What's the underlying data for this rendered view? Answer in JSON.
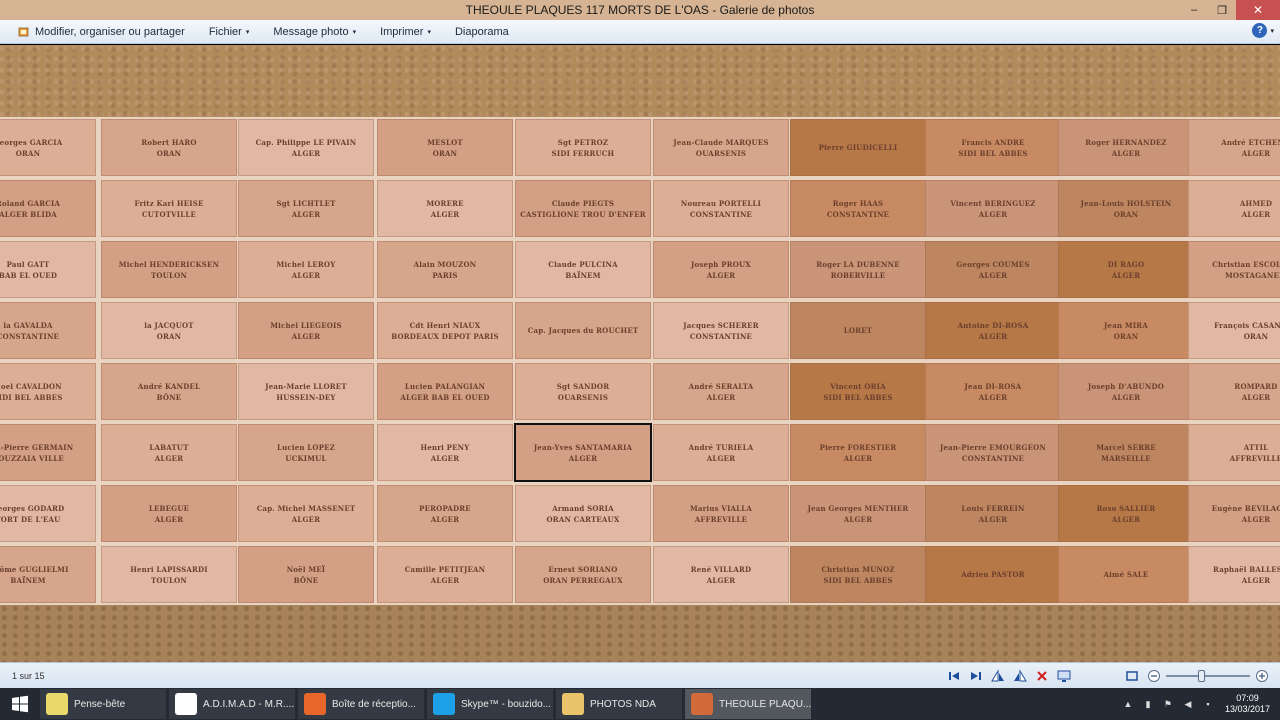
{
  "window": {
    "title": "THEOULE PLAQUES 117 MORTS DE L'OAS - Galerie de photos",
    "minimize": "–",
    "maximize": "❐",
    "close": "✕"
  },
  "toolbar": {
    "items": [
      {
        "label": "Modifier, organiser ou partager",
        "icon": "edit-icon"
      },
      {
        "label": "Fichier",
        "caret": "▾"
      },
      {
        "label": "Message photo",
        "caret": "▾"
      },
      {
        "label": "Imprimer",
        "caret": "▾"
      },
      {
        "label": "Diaporama"
      }
    ],
    "help": "?",
    "help_caret": "▾"
  },
  "photo": {
    "highlighted": "Jean-Yves SANTAMARIA / ALGER",
    "columns": [
      [
        [
          "Georges GARCIA",
          "ORAN"
        ],
        [
          "Roland GARCIA",
          "ALGER      BLIDA"
        ],
        [
          "Paul GATT",
          "BAB EL OUED"
        ],
        [
          "la GAVALDA",
          "CONSTANTINE"
        ],
        [
          "Noel CAVALDON",
          "SIDI BEL ABBES"
        ],
        [
          "Jean-Pierre GERMAIN",
          "BOUZZAIA VILLE"
        ],
        [
          "Georges GODARD",
          "FORT DE L'EAU"
        ],
        [
          "Jérôme GUGLIELMI",
          "BAÏNEM"
        ]
      ],
      [
        [
          "Robert HARO",
          "ORAN"
        ],
        [
          "Fritz Karl HEISE",
          "CUTOTVILLE"
        ],
        [
          "Michel HENDERICKSEN",
          "TOULON"
        ],
        [
          "la JACQUOT",
          "ORAN"
        ],
        [
          "André KANDEL",
          "BÔNE"
        ],
        [
          "LABATUT",
          "ALGER"
        ],
        [
          "LEBEGUE",
          "ALGER"
        ],
        [
          "Henri LAPISSARDI",
          "TOULON"
        ]
      ],
      [
        [
          "Cap. Philippe LE PIVAIN",
          "ALGER"
        ],
        [
          "Sgt LICHTLET",
          "ALGER"
        ],
        [
          "Michel LEROY",
          "ALGER"
        ],
        [
          "Michel LIEGEOIS",
          "ALGER"
        ],
        [
          "Jean-Marie LLORET",
          "HUSSEIN-DEY"
        ],
        [
          "Lucien LOPEZ",
          "UCKIMUL"
        ],
        [
          "Cap. Michel MASSENET",
          "ALGER"
        ],
        [
          "Noël MEÏ",
          "BÔNE"
        ]
      ],
      [
        [
          "MESLOT",
          "ORAN"
        ],
        [
          "MORERE",
          "ALGER"
        ],
        [
          "Alain MOUZON",
          "PARIS"
        ],
        [
          "Cdt Henri NIAUX",
          "BORDEAUX     DEPOT PARIS"
        ],
        [
          "Lucien PALANGIAN",
          "ALGER     BAB EL OUED"
        ],
        [
          "Henri PENY",
          "ALGER"
        ],
        [
          "PEROPADRE",
          "ALGER"
        ],
        [
          "Camille PETITJEAN",
          "ALGER"
        ]
      ],
      [
        [
          "Sgt PETROZ",
          "SIDI FERRUCH"
        ],
        [
          "Claude PIEGTS",
          "CASTIGLIONE     TROU D'ENFER"
        ],
        [
          "Claude PULCINA",
          "BAÏNEM"
        ],
        [
          "Cap. Jacques du ROUCHET",
          ""
        ],
        [
          "Sgt SANDOR",
          "OUARSENIS"
        ],
        [
          "Jean-Yves SANTAMARIA",
          "ALGER"
        ],
        [
          "Armand SORIA",
          "ORAN     CARTEAUX"
        ],
        [
          "Ernest SORIANO",
          "ORAN     PERREGAUX"
        ]
      ],
      [
        [
          "Jean-Claude MARQUES",
          "OUARSENIS"
        ],
        [
          "Noureau PORTELLI",
          "CONSTANTINE"
        ],
        [
          "Joseph PROUX",
          "ALGER"
        ],
        [
          "Jacques SCHERER",
          "CONSTANTINE"
        ],
        [
          "André SERALTA",
          "ALGER"
        ],
        [
          "André TURIELA",
          "ALGER"
        ],
        [
          "Marius VIALLA",
          "AFFREVILLE"
        ],
        [
          "René VILLARD",
          "ALGER"
        ]
      ],
      [
        [
          "Pierre GIUDICELLI",
          ""
        ],
        [
          "Roger HAAS",
          "CONSTANTINE"
        ],
        [
          "Roger LA DUBENNE",
          "ROBERVILLE"
        ],
        [
          "LORET",
          ""
        ],
        [
          "Vincent ORIA",
          "SIDI BEL ABBES"
        ],
        [
          "Pierre FORESTIER",
          "ALGER"
        ],
        [
          "Jean Georges MENTHER",
          "ALGER"
        ],
        [
          "Christian MUNOZ",
          "SIDI BEL ABBES"
        ]
      ],
      [
        [
          "Francis ANDRE",
          "SIDI BEL ABBES"
        ],
        [
          "Vincent BERINGUEZ",
          "ALGER"
        ],
        [
          "Georges COUMES",
          "ALGER"
        ],
        [
          "Antoine DI-ROSA",
          "ALGER"
        ],
        [
          "Jean DI-ROSA",
          "ALGER"
        ],
        [
          "Jean-Pierre EMOURGEON",
          "CONSTANTINE"
        ],
        [
          "Louis FERREIN",
          "ALGER"
        ],
        [
          "Adrien PASTOR",
          ""
        ]
      ],
      [
        [
          "Roger HERNANDEZ",
          "ALGER"
        ],
        [
          "Jean-Louis HOLSTEIN",
          "ORAN"
        ],
        [
          "DI RAGO",
          "ALGER"
        ],
        [
          "Jean MIRA",
          "ORAN"
        ],
        [
          "Joseph D'ABUNDO",
          "ALGER"
        ],
        [
          "Marcel SERRE",
          "MARSEILLE"
        ],
        [
          "Roso SALLIER",
          "ALGER"
        ],
        [
          "Aimé SALE",
          ""
        ]
      ],
      [
        [
          "André ETCHENN",
          "ALGER"
        ],
        [
          "AHMED",
          "ALGER"
        ],
        [
          "Christian ESCOLANO",
          "MOSTAGANEM"
        ],
        [
          "François CASANOVA",
          "ORAN"
        ],
        [
          "ROMPARD",
          "ALGER"
        ],
        [
          "ATTIL",
          "AFFREVILLE"
        ],
        [
          "Eugène BEVILACQUA",
          "ALGER"
        ],
        [
          "Raphaël BALLESTER",
          "ALGER"
        ]
      ]
    ]
  },
  "statusbar": {
    "counter": "1 sur 15",
    "zoom_level": 0.42
  },
  "taskbar": {
    "tasks": [
      {
        "label": "Pense-bête",
        "icon": "sticky-notes-icon",
        "color": "#e8d96a"
      },
      {
        "label": "A.D.I.M.A.D - M.R....",
        "icon": "chrome-icon",
        "color": "#ffffff"
      },
      {
        "label": "Boîte de réceptio...",
        "icon": "mail-icon",
        "color": "#e8662a"
      },
      {
        "label": "Skype™ - bouzido...",
        "icon": "skype-icon",
        "color": "#1ea0e6"
      },
      {
        "label": "PHOTOS NDA",
        "icon": "folder-icon",
        "color": "#e9c46a"
      },
      {
        "label": "THEOULE PLAQU...",
        "icon": "photo-gallery-icon",
        "color": "#d36a3a"
      }
    ],
    "active_task": 5,
    "time": "07:09",
    "date": "13/03/2017"
  },
  "colors": {
    "title_bar": "#d6b493",
    "close_button": "#c75050",
    "taskbar": "#232a33",
    "plaque_text": "#6b3f2c"
  }
}
